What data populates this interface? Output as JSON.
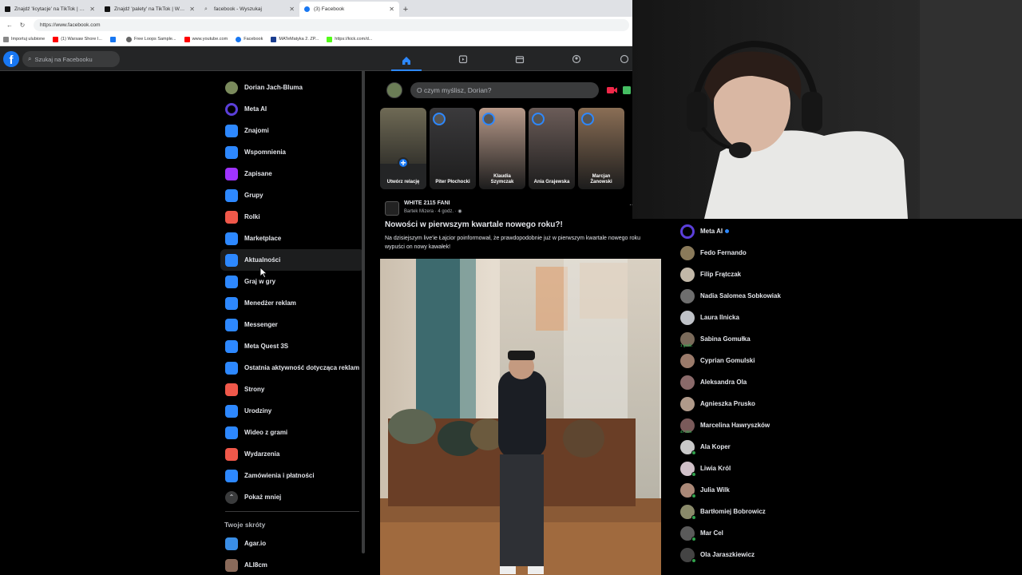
{
  "browser": {
    "tabs": [
      {
        "title": "Znajdź 'licytacje' na TikTok | Wyszuk",
        "color": "#000000"
      },
      {
        "title": "Znajdź 'palety' na TikTok | Wyszuk",
        "color": "#000000"
      },
      {
        "title": "facebook - Wyszukaj",
        "color": "#4285f4"
      },
      {
        "title": "(3) Facebook",
        "color": "#1877f2"
      }
    ],
    "new_tab": "+",
    "url": "https://www.facebook.com",
    "bookmarks": [
      {
        "label": "Importuj ulubione",
        "color": "#888888"
      },
      {
        "label": "(1) Warsaw Shore I...",
        "color": "#ff0000"
      },
      {
        "label": "",
        "color": "#1877f2"
      },
      {
        "label": "Free Loops Sample...",
        "color": "#666666"
      },
      {
        "label": "www.youtube.com",
        "color": "#ff0000"
      },
      {
        "label": "Facebook",
        "color": "#1877f2"
      },
      {
        "label": "MATeMatyka 2. ZP...",
        "color": "#1a3d8f"
      },
      {
        "label": "https://kick.com/d...",
        "color": "#53fc18"
      }
    ]
  },
  "fb": {
    "search_placeholder": "Szukaj na Facebooku",
    "composer_prompt": "O czym myślisz, Dorian?",
    "sidebar": [
      {
        "label": "Dorian Jach-Bluma",
        "icon": "avatar",
        "color": "#7a8a5c"
      },
      {
        "label": "Meta AI",
        "icon": "meta-ai-icon",
        "color": "#5b3fd9"
      },
      {
        "label": "Znajomi",
        "icon": "friends-icon",
        "color": "#2d88ff"
      },
      {
        "label": "Wspomnienia",
        "icon": "memories-icon",
        "color": "#2d88ff"
      },
      {
        "label": "Zapisane",
        "icon": "saved-icon",
        "color": "#a033ff"
      },
      {
        "label": "Grupy",
        "icon": "groups-icon",
        "color": "#2d88ff"
      },
      {
        "label": "Rolki",
        "icon": "reels-icon",
        "color": "#f0584a"
      },
      {
        "label": "Marketplace",
        "icon": "marketplace-icon",
        "color": "#2d88ff"
      },
      {
        "label": "Aktualności",
        "icon": "feeds-icon",
        "color": "#2d88ff"
      },
      {
        "label": "Graj w gry",
        "icon": "gaming-icon",
        "color": "#2d88ff"
      },
      {
        "label": "Menedżer reklam",
        "icon": "ads-manager-icon",
        "color": "#2d88ff"
      },
      {
        "label": "Messenger",
        "icon": "messenger-icon",
        "color": "#2d88ff"
      },
      {
        "label": "Meta Quest 3S",
        "icon": "meta-quest-icon",
        "color": "#2d88ff"
      },
      {
        "label": "Ostatnia aktywność dotycząca reklam",
        "icon": "ad-activity-icon",
        "color": "#2d88ff"
      },
      {
        "label": "Strony",
        "icon": "pages-icon",
        "color": "#f0584a"
      },
      {
        "label": "Urodziny",
        "icon": "birthday-icon",
        "color": "#2d88ff"
      },
      {
        "label": "Wideo z grami",
        "icon": "gaming-video-icon",
        "color": "#2d88ff"
      },
      {
        "label": "Wydarzenia",
        "icon": "events-icon",
        "color": "#f0584a"
      },
      {
        "label": "Zamówienia i płatności",
        "icon": "orders-icon",
        "color": "#2d88ff"
      },
      {
        "label": "Pokaż mniej",
        "icon": "chevron-up-icon",
        "color": "#3a3b3c"
      }
    ],
    "shortcuts_heading": "Twoje skróty",
    "shortcuts": [
      {
        "label": "Agar.io",
        "color": "#3a8ee6"
      },
      {
        "label": "ALI8cm",
        "color": "#8a6a5a"
      }
    ],
    "stories": [
      {
        "name": "Utwórz relację",
        "color": "#6f6a55"
      },
      {
        "name": "Piter Płochocki",
        "color": "#3b3a3c"
      },
      {
        "name": "Klaudia Szymczak",
        "color": "#b89a8a"
      },
      {
        "name": "Ania Grajewska",
        "color": "#6b5c58"
      },
      {
        "name": "Marcjan Żanowski",
        "color": "#8a6e55"
      }
    ],
    "post": {
      "author": "WHITE 2115 FANI",
      "meta": "Bartek Mizera · 4 godz. ·",
      "title": "Nowości w pierwszym kwartale nowego roku?!",
      "body": "Na dzisiejszym live'ie Łajcior poinformował, że prawdopodobnie już w pierwszym kwartale nowego roku wypuści on nowy kawałek!"
    },
    "contacts": [
      {
        "name": "Meta AI",
        "color": "#5b3fd9",
        "online": false,
        "since": ""
      },
      {
        "name": "Fedo Fernando",
        "color": "#8a7a5a",
        "online": false,
        "since": ""
      },
      {
        "name": "Filip Frątczak",
        "color": "#c2b8a8",
        "online": false,
        "since": ""
      },
      {
        "name": "Nadia Salomea Sobkowiak",
        "color": "#6e6e6e",
        "online": false,
        "since": ""
      },
      {
        "name": "Laura Ilnicka",
        "color": "#bfc2c7",
        "online": false,
        "since": ""
      },
      {
        "name": "Sabina Gomułka",
        "color": "#7a6a5a",
        "online": false,
        "since": "1 godz."
      },
      {
        "name": "Cyprian Gomulski",
        "color": "#9a7a6a",
        "online": false,
        "since": ""
      },
      {
        "name": "Aleksandra Ola",
        "color": "#8a6a6a",
        "online": false,
        "since": ""
      },
      {
        "name": "Agnieszka Prusko",
        "color": "#b09a8a",
        "online": false,
        "since": ""
      },
      {
        "name": "Marcelina Hawryszków",
        "color": "#7a5a5a",
        "online": false,
        "since": "47 min"
      },
      {
        "name": "Ala Koper",
        "color": "#c8c8c8",
        "online": true,
        "since": ""
      },
      {
        "name": "Liwia Król",
        "color": "#d0c0c8",
        "online": true,
        "since": ""
      },
      {
        "name": "Julia Wilk",
        "color": "#aa8877",
        "online": true,
        "since": ""
      },
      {
        "name": "Bartłomiej Bobrowicz",
        "color": "#8a8a6a",
        "online": true,
        "since": ""
      },
      {
        "name": "Mar Cel",
        "color": "#5a5a5a",
        "online": true,
        "since": ""
      },
      {
        "name": "Ola Jaraszkiewicz",
        "color": "#444444",
        "online": true,
        "since": ""
      }
    ]
  }
}
